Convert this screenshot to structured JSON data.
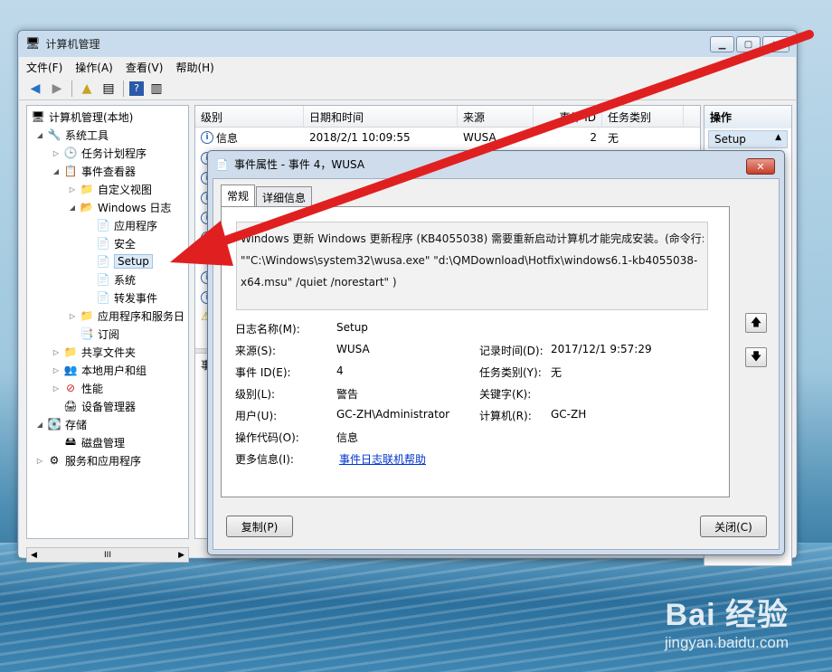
{
  "main_window": {
    "title": "计算机管理",
    "menu": [
      "文件(F)",
      "操作(A)",
      "查看(V)",
      "帮助(H)"
    ],
    "win_buttons": {
      "min": "▁",
      "max": "▢",
      "close": "✕"
    }
  },
  "tree": {
    "root": "计算机管理(本地)",
    "system_tools": "系统工具",
    "task_scheduler": "任务计划程序",
    "event_viewer": "事件查看器",
    "custom_views": "自定义视图",
    "windows_logs": "Windows 日志",
    "application": "应用程序",
    "security": "安全",
    "setup": "Setup",
    "system": "系统",
    "forwarded": "转发事件",
    "apps_services": "应用程序和服务日",
    "subscriptions": "订阅",
    "shared_folders": "共享文件夹",
    "local_users": "本地用户和组",
    "performance": "性能",
    "device_manager": "设备管理器",
    "storage": "存储",
    "disk_mgmt": "磁盘管理",
    "services_apps": "服务和应用程序",
    "scroll_mid": "III"
  },
  "event_list": {
    "columns": [
      "级别",
      "日期和时间",
      "来源",
      "事件 ID",
      "任务类别"
    ],
    "first_row": {
      "level": "信息",
      "datetime": "2018/2/1 10:09:55",
      "source": "WUSA",
      "id": "2",
      "category": "无"
    },
    "lower_tab": "事"
  },
  "actions_pane": {
    "header": "操作",
    "item": "Setup"
  },
  "dialog": {
    "title": "事件属性 - 事件 4，WUSA",
    "tabs": [
      "常规",
      "详细信息"
    ],
    "description_lines": [
      "Windows 更新 Windows 更新程序 (KB4055038) 需要重新启动计算机才能完成安装。(命令行:",
      "\"\"C:\\Windows\\system32\\wusa.exe\" \"d:\\QMDownload\\Hotfix\\windows6.1-kb4055038-",
      "x64.msu\"   /quiet /norestart\" )"
    ],
    "fields": {
      "log_name_label": "日志名称(M):",
      "log_name": "Setup",
      "source_label": "来源(S):",
      "source": "WUSA",
      "logged_label": "记录时间(D):",
      "logged": "2017/12/1 9:57:29",
      "event_id_label": "事件 ID(E):",
      "event_id": "4",
      "task_cat_label": "任务类别(Y):",
      "task_cat": "无",
      "level_label": "级别(L):",
      "level": "警告",
      "keywords_label": "关键字(K):",
      "keywords": "",
      "user_label": "用户(U):",
      "user": "GC-ZH\\Administrator",
      "computer_label": "计算机(R):",
      "computer": "GC-ZH",
      "opcode_label": "操作代码(O):",
      "opcode": "信息",
      "more_info_label": "更多信息(I):",
      "more_info_link": "事件日志联机帮助"
    },
    "copy_button": "复制(P)",
    "close_button": "关闭(C)"
  },
  "watermark": {
    "brand": "Bai  经验",
    "url": "jingyan.baidu.com"
  },
  "colors": {
    "arrow": "#e02020",
    "link": "#0033cc",
    "window_frame": "#c9dcee"
  }
}
